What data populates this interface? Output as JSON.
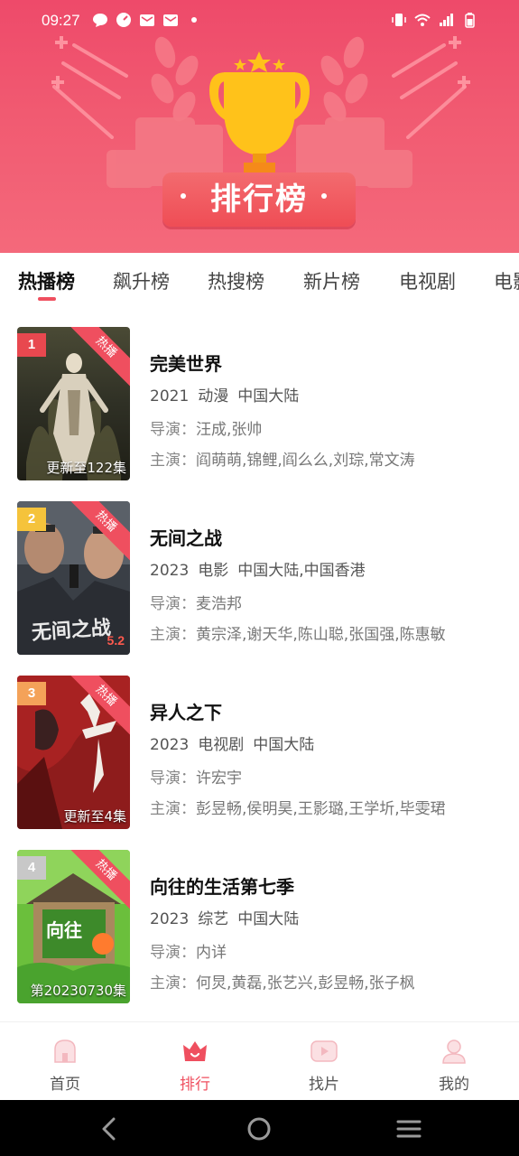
{
  "status_bar": {
    "time": "09:27"
  },
  "banner": {
    "title": "排行榜",
    "colors": {
      "gradient_top": "#ee4a6a",
      "gradient_bottom": "#f4697b",
      "trophy": "#ffc21a"
    }
  },
  "tabs": [
    {
      "label": "热播榜",
      "active": true
    },
    {
      "label": "飙升榜",
      "active": false
    },
    {
      "label": "热搜榜",
      "active": false
    },
    {
      "label": "新片榜",
      "active": false
    },
    {
      "label": "电视剧",
      "active": false
    },
    {
      "label": "电影",
      "active": false
    }
  ],
  "hot_tag": "热播",
  "items": [
    {
      "rank": "1",
      "rank_color": "#e8484f",
      "title": "完美世界",
      "year": "2021",
      "genre": "动漫",
      "region": "中国大陆",
      "director_label": "导演：",
      "director": "汪成,张帅",
      "cast_label": "主演：",
      "cast": "阎萌萌,锦鲤,阎么么,刘琮,常文涛",
      "poster_note": "更新至122集",
      "poster_score": ""
    },
    {
      "rank": "2",
      "rank_color": "#f5c33b",
      "title": "无间之战",
      "year": "2023",
      "genre": "电影",
      "region": "中国大陆,中国香港",
      "director_label": "导演：",
      "director": "麦浩邦",
      "cast_label": "主演：",
      "cast": "黄宗泽,谢天华,陈山聪,张国强,陈惠敏",
      "poster_note": "",
      "poster_score": "5.2"
    },
    {
      "rank": "3",
      "rank_color": "#f4a259",
      "title": "异人之下",
      "year": "2023",
      "genre": "电视剧",
      "region": "中国大陆",
      "director_label": "导演：",
      "director": "许宏宇",
      "cast_label": "主演：",
      "cast": "彭昱畅,侯明昊,王影璐,王学圻,毕雯珺",
      "poster_note": "更新至4集",
      "poster_score": ""
    },
    {
      "rank": "4",
      "rank_color": "#c8c8c8",
      "title": "向往的生活第七季",
      "year": "2023",
      "genre": "综艺",
      "region": "中国大陆",
      "director_label": "导演：",
      "director": "内详",
      "cast_label": "主演：",
      "cast": "何炅,黄磊,张艺兴,彭昱畅,张子枫",
      "poster_note": "第20230730集",
      "poster_score": ""
    }
  ],
  "bottom_nav": [
    {
      "label": "首页",
      "icon": "home-icon",
      "active": false
    },
    {
      "label": "排行",
      "icon": "crown-icon",
      "active": true
    },
    {
      "label": "找片",
      "icon": "play-icon",
      "active": false
    },
    {
      "label": "我的",
      "icon": "user-icon",
      "active": false
    }
  ],
  "accent_color": "#ef4f5f"
}
